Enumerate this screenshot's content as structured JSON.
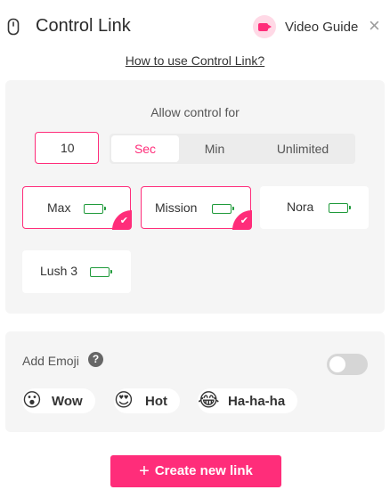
{
  "header": {
    "title": "Control Link",
    "video_guide_label": "Video Guide",
    "close_glyph": "×",
    "icons": [
      "remote-icon",
      "video-camera-icon",
      "close-icon"
    ]
  },
  "how_to_link": "How to use Control Link?",
  "control": {
    "allow_label": "Allow control for",
    "time_value": "10",
    "units": [
      {
        "label": "Sec",
        "selected": true
      },
      {
        "label": "Min",
        "selected": false
      },
      {
        "label": "Unlimited",
        "selected": false
      }
    ],
    "toys": [
      {
        "name": "Max",
        "selected": true,
        "battery": 1.0
      },
      {
        "name": "Mission",
        "selected": true,
        "battery": 1.0
      },
      {
        "name": "Nora",
        "selected": false,
        "battery": 1.0
      },
      {
        "name": "Lush 3",
        "selected": false,
        "battery": 1.0
      }
    ]
  },
  "emoji": {
    "label": "Add Emoji",
    "help_glyph": "?",
    "enabled": false,
    "options": [
      {
        "label": "Wow",
        "glyph": "😮"
      },
      {
        "label": "Hot",
        "glyph": "😍"
      },
      {
        "label": "Ha-ha-ha",
        "glyph": "😂"
      }
    ]
  },
  "create_button": {
    "plus": "+",
    "label": "Create new link"
  },
  "colors": {
    "accent": "#ff2d7a",
    "battery": "#23c244",
    "panel": "#f5f5f5"
  }
}
